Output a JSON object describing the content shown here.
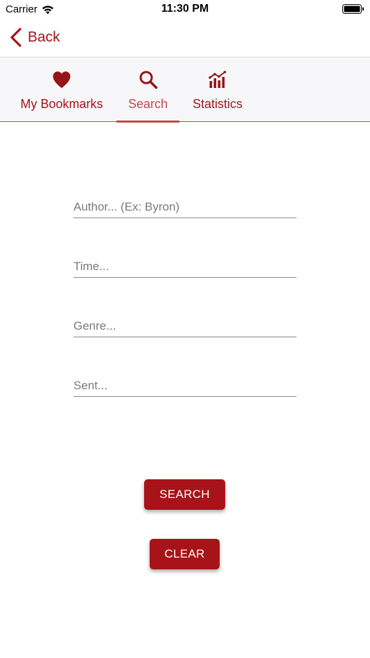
{
  "status_bar": {
    "carrier": "Carrier",
    "time": "11:30 PM"
  },
  "nav": {
    "back_label": "Back"
  },
  "tabs": [
    {
      "label": "My Bookmarks",
      "icon": "heart-icon",
      "active": false
    },
    {
      "label": "Search",
      "icon": "search-icon",
      "active": true
    },
    {
      "label": "Statistics",
      "icon": "bar-chart-icon",
      "active": false
    }
  ],
  "form": {
    "author_placeholder": "Author... (Ex: Byron)",
    "time_placeholder": "Time...",
    "genre_placeholder": "Genre...",
    "sent_placeholder": "Sent...",
    "search_label": "SEARCH",
    "clear_label": "CLEAR"
  },
  "colors": {
    "accent": "#a5151b",
    "active_tab": "#c5464b",
    "button": "#a71318",
    "tab_bar_bg": "#f7f7f9"
  }
}
